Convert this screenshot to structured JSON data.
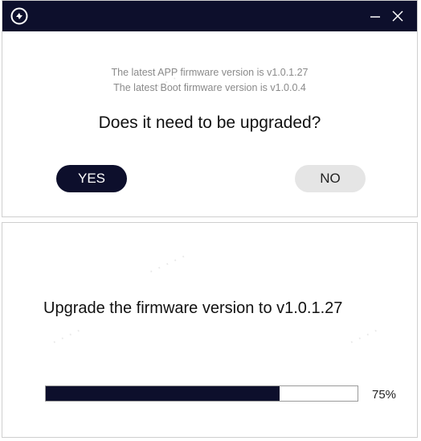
{
  "colors": {
    "titlebar": "#0d0f2c",
    "primary_button": "#0d0f2c",
    "secondary_button": "#e5e5e5",
    "progress_fill": "#0d0f2c"
  },
  "dialog1": {
    "titlebar": {
      "logo_icon": "app-logo-icon",
      "minimize_icon": "minimize-icon",
      "close_icon": "close-icon"
    },
    "app_firmware_text": "The latest APP firmware version is v1.0.1.27",
    "boot_firmware_text": "The latest Boot firmware version is v1.0.0.4",
    "question": "Does it need to be upgraded?",
    "yes_label": "YES",
    "no_label": "NO"
  },
  "dialog2": {
    "message": "Upgrade the firmware version to v1.0.1.27",
    "progress_percent": 75,
    "progress_label": "75%"
  }
}
